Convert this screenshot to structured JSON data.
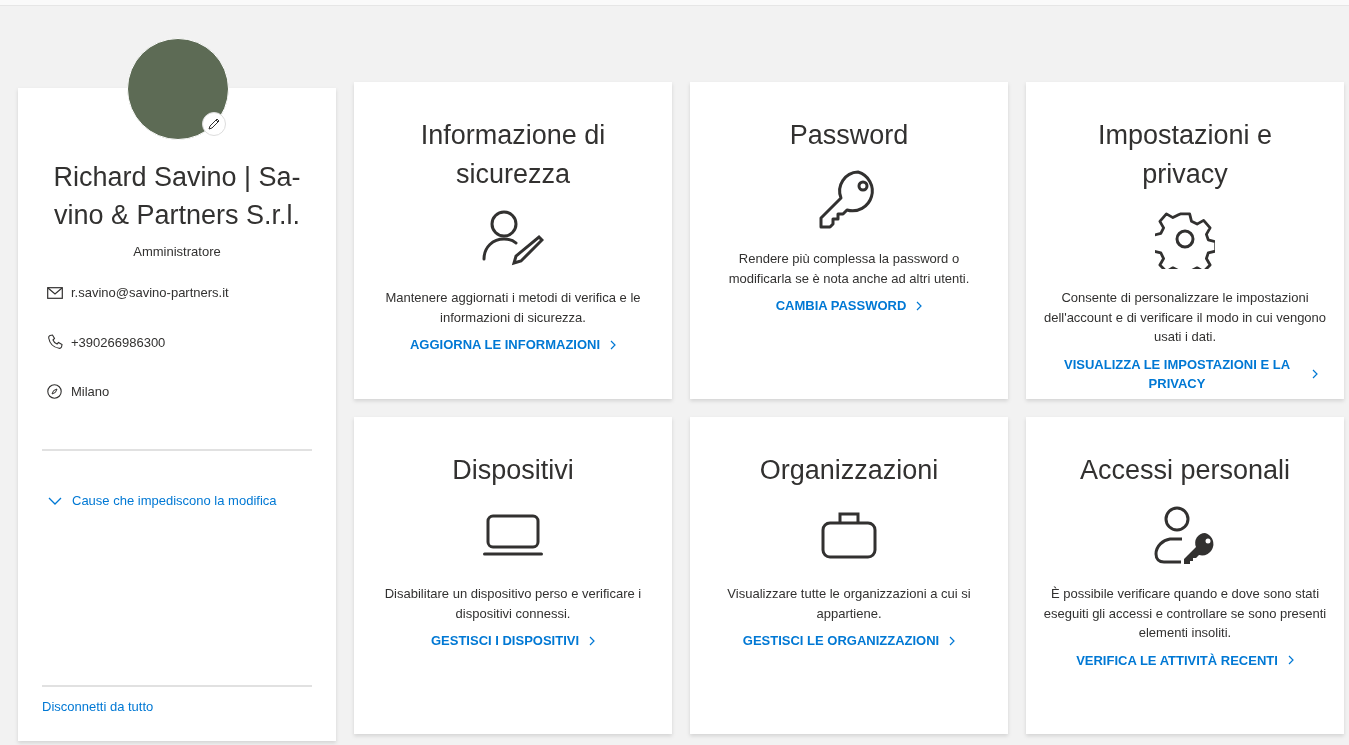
{
  "profile": {
    "name": "Richard Savino | Sa-vino & Partners S.r.l.",
    "role": "Amministratore",
    "contacts": [
      {
        "kind": "email",
        "text": "r.savino@savino-partners.it"
      },
      {
        "kind": "phone",
        "text": "+390266986300"
      },
      {
        "kind": "location",
        "text": "Milano"
      }
    ],
    "edit_restrictions_link": {
      "text": "Cause che impediscono la modifica",
      "expanded": false
    },
    "sign_out_link": "Disconnetti da tutto"
  },
  "tiles": [
    {
      "kind": "security-info",
      "title": "Informazione di sicurezza",
      "description": "Mantenere aggiornati i metodi di verifica e le informazioni di sicurezza.",
      "link": "AGGIORNA LE INFORMAZIONI"
    },
    {
      "kind": "password",
      "title": "Password",
      "description": "Rendere più complessa la password o modificarla se è nota anche ad altri utenti.",
      "link": "CAMBIA PASSWORD"
    },
    {
      "kind": "settings",
      "title": "Impostazioni e privacy",
      "description": "Consente di personalizzare le impostazioni dell'account e di verificare il modo in cui vengono usati i dati.",
      "link": "VISUALIZZA LE IMPOSTAZIONI E LA PRIVACY"
    },
    {
      "kind": "devices",
      "title": "Dispositivi",
      "description": "Disabilitare un dispositivo perso e verificare i dispositivi connessi.",
      "link": "GESTISCI I DISPOSITIVI"
    },
    {
      "kind": "organizations",
      "title": "Organizzazioni",
      "description": "Visualizzare tutte le organizzazioni a cui si appartiene.",
      "link": "GESTISCI LE ORGANIZZAZIONI"
    },
    {
      "kind": "sign-ins",
      "title": "Accessi personali",
      "description": "È possibile verificare quando e dove sono stati eseguiti gli accessi e controllare se sono presenti elementi insoliti.",
      "link": "VERIFICA LE ATTIVITÀ RECENTI"
    }
  ]
}
